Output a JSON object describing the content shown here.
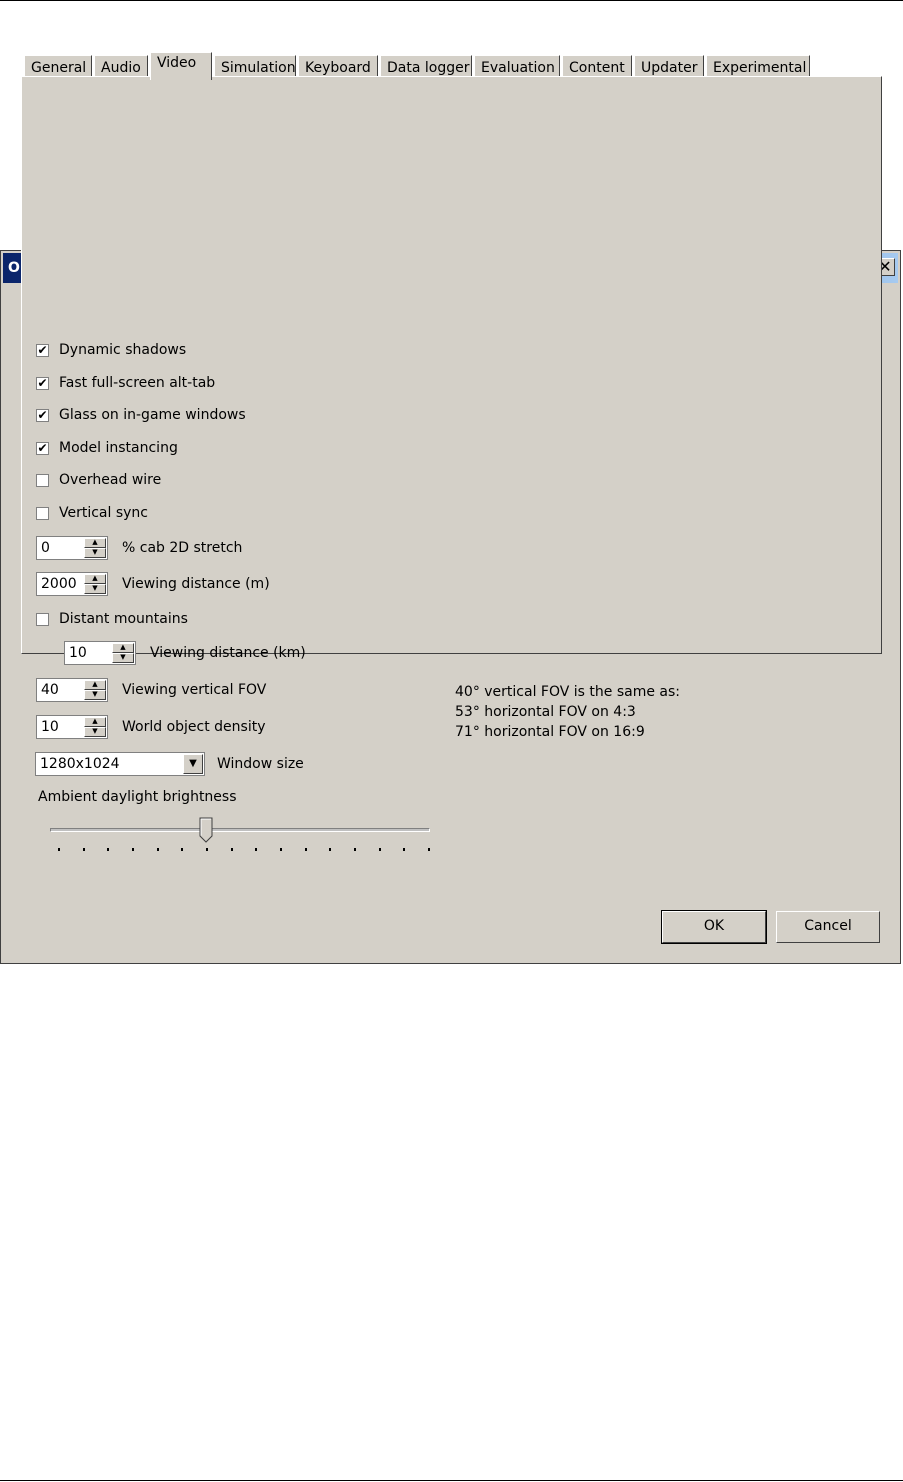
{
  "window": {
    "title": "Options",
    "close_glyph": "✕"
  },
  "tabs": [
    {
      "label": "General"
    },
    {
      "label": "Audio"
    },
    {
      "label": "Video",
      "active": true
    },
    {
      "label": "Simulation"
    },
    {
      "label": "Keyboard"
    },
    {
      "label": "Data logger"
    },
    {
      "label": "Evaluation"
    },
    {
      "label": "Content"
    },
    {
      "label": "Updater"
    },
    {
      "label": "Experimental"
    }
  ],
  "video": {
    "dynamic_shadows": {
      "label": "Dynamic shadows",
      "checked": true
    },
    "fast_alt_tab": {
      "label": "Fast full-screen alt-tab",
      "checked": true
    },
    "glass_windows": {
      "label": "Glass on in-game windows",
      "checked": true
    },
    "model_instancing": {
      "label": "Model instancing",
      "checked": true
    },
    "overhead_wire": {
      "label": "Overhead wire",
      "checked": false
    },
    "vertical_sync": {
      "label": "Vertical sync",
      "checked": false
    },
    "cab_stretch": {
      "value": "0",
      "label": "% cab 2D stretch"
    },
    "viewing_distance": {
      "value": "2000",
      "label": "Viewing distance (m)"
    },
    "distant_mountains": {
      "label": "Distant mountains",
      "checked": false
    },
    "mountain_distance": {
      "value": "10",
      "label": "Viewing distance (km)"
    },
    "vertical_fov": {
      "value": "40",
      "label": "Viewing vertical FOV"
    },
    "world_density": {
      "value": "10",
      "label": "World object density"
    },
    "window_size": {
      "value": "1280x1024",
      "label": "Window size"
    },
    "fov_note": [
      "40° vertical FOV is the same as:",
      "53° horizontal FOV on 4:3",
      "71° horizontal FOV on 16:9"
    ],
    "brightness": {
      "label": "Ambient daylight brightness",
      "value": 6,
      "min": 0,
      "max": 15
    }
  },
  "buttons": {
    "ok": "OK",
    "cancel": "Cancel"
  },
  "check_glyph": "✔"
}
